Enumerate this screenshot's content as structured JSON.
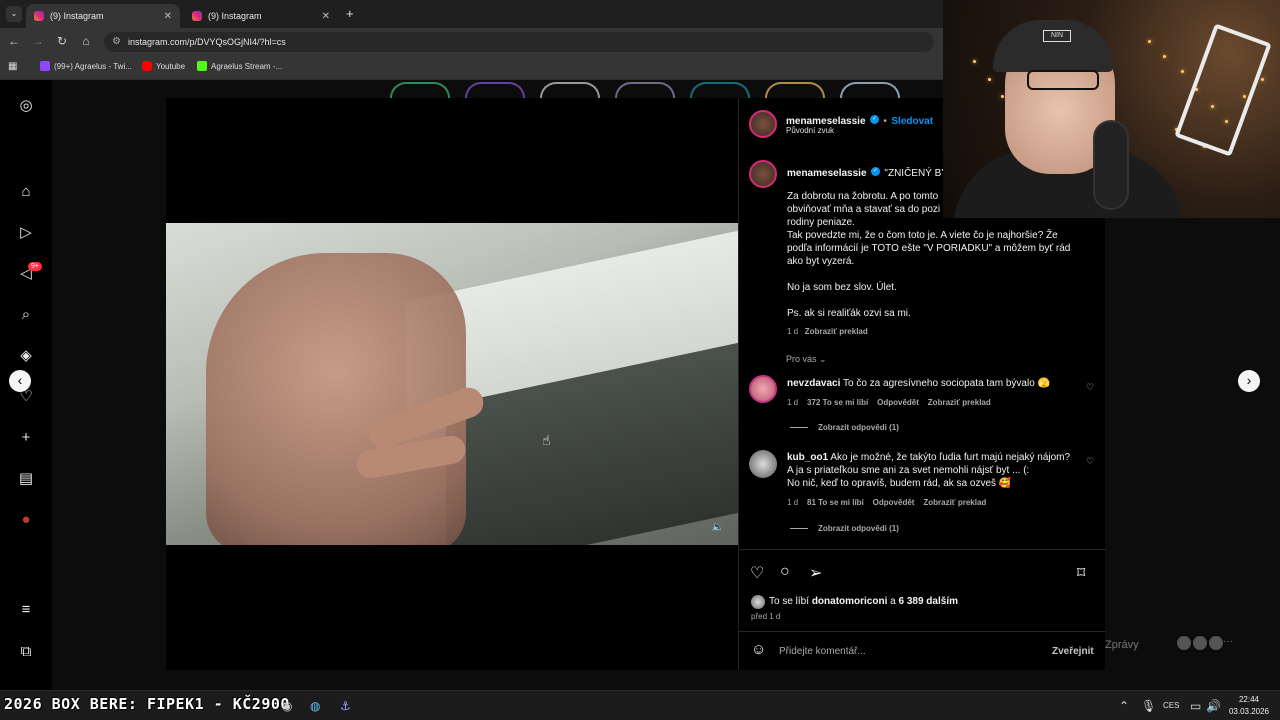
{
  "browser": {
    "tabs": [
      {
        "label": "(9) Instagram",
        "active": true
      },
      {
        "label": "(9) Instagram",
        "active": false
      }
    ],
    "url": "instagram.com/p/DVYQsOGjNI4/?hl=cs",
    "bookmarks": [
      "(99+) Agraelus - Twi...",
      "Youtube",
      "Agraelus Stream -..."
    ]
  },
  "sidebar": {
    "notification_badge": "9+",
    "icons": [
      "instagram-icon",
      "home-icon",
      "reels-icon",
      "messages-icon",
      "search-icon",
      "explore-icon",
      "notifications-icon",
      "create-icon",
      "dashboard-icon",
      "profile-icon",
      "menu-icon",
      "apps-icon"
    ]
  },
  "post": {
    "author": "menameselassie",
    "follow_label": "Sledovat",
    "audio": "Původní zvuk",
    "caption_title": "\"ZNIČENÝ BYT",
    "caption_lines": [
      "Za dobrotu na žobrotu. A po tomto",
      "obviňovať mňa a stavať sa do pozi",
      "rodiny peniaze.",
      "Tak povedzte mi, že o čom toto je. A viete čo je najhoršie? Že",
      "podľa informácií je TOTO ešte \"V PORIADKU\" a môžem byť rád",
      "ako byt vyzerá."
    ],
    "caption_p2": "No ja som bez slov. Úlet.",
    "caption_p3": "Ps. ak si realiťák ozvi sa mi.",
    "caption_time": "1 d",
    "caption_translate": "Zobraziť preklad",
    "for_you_label": "Pro vás",
    "comments": [
      {
        "user": "nevzdavaci",
        "text": "To čo za agresívneho sociopata tam bývalo 🫣",
        "time": "1 d",
        "likes": "372 To se mi líbí",
        "reply": "Odpovědět",
        "translate": "Zobraziť preklad",
        "view_replies": "Zobrazit odpovědi (1)"
      },
      {
        "user": "kub_oo1",
        "text_lines": [
          "Ako je možné, že takýto ľudia furt majú nejaký nájom?",
          "A ja s priateľkou sme ani za svet nemohli nájsť byt ... (:",
          "No nič, keď to opravíš, budem rád, ak sa ozveš 🥰"
        ],
        "time": "1 d",
        "likes": "81 To se mi líbí",
        "reply": "Odpovědět",
        "translate": "Zobraziť preklad",
        "view_replies": "Zobrazit odpovědi (1)"
      }
    ],
    "likes_prefix": "To se líbí",
    "likes_user": "donatomoriconi",
    "likes_and": "a",
    "likes_rest": "6 389 dalším",
    "posted": "před 1 d",
    "comment_placeholder": "Přidejte komentář...",
    "publish_label": "Zveřejnit"
  },
  "messages_label": "Zprávy",
  "taskbar": {
    "ticker": "2026 BOX BERE: FIPEK1 - KČ2900",
    "lang": "CES",
    "time": "22:44",
    "date": "03.03.2026"
  },
  "colors": {
    "follow": "#0095f6",
    "verified": "#0095f6",
    "badge": "#ff3040",
    "panel_bg": "#000000"
  }
}
